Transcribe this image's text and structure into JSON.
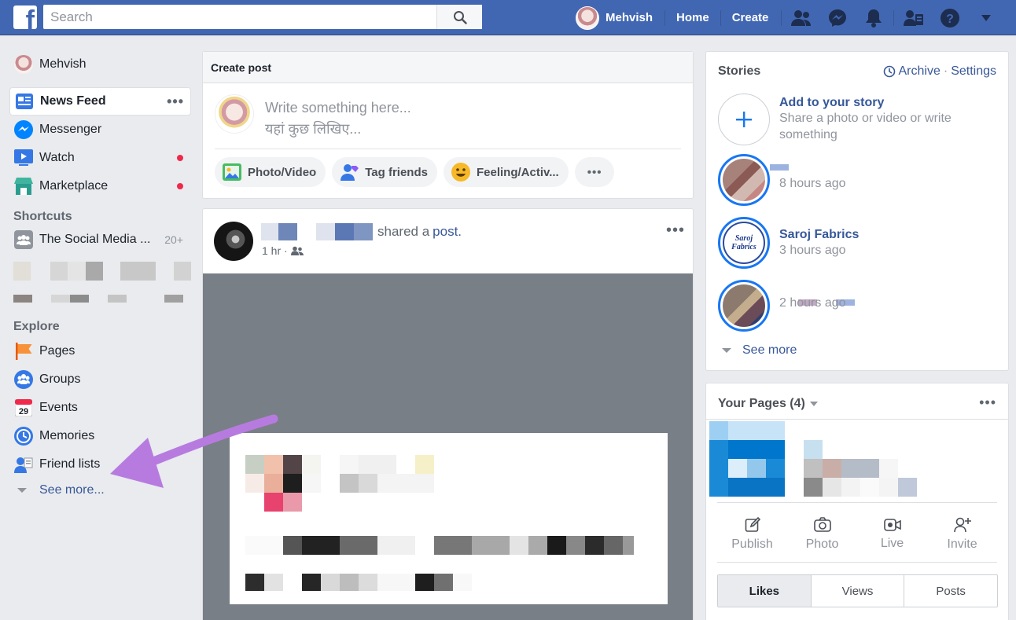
{
  "topbar": {
    "logo": "f",
    "search_placeholder": "Search",
    "user_name": "Mehvish",
    "links": [
      "Home",
      "Create"
    ],
    "icons": [
      "friend-requests-icon",
      "messenger-icon",
      "notifications-icon",
      "find-friends-icon",
      "help-icon",
      "chevron-down-icon"
    ]
  },
  "leftnav": {
    "profile": "Mehvish",
    "main": [
      {
        "label": "News Feed",
        "icon": "news-feed-icon",
        "active": true
      },
      {
        "label": "Messenger",
        "icon": "messenger-icon"
      },
      {
        "label": "Watch",
        "icon": "watch-icon",
        "dot": true
      },
      {
        "label": "Marketplace",
        "icon": "marketplace-icon",
        "dot": true
      }
    ],
    "shortcuts_heading": "Shortcuts",
    "shortcut": {
      "label": "The Social Media ...",
      "count": "20+"
    },
    "explore_heading": "Explore",
    "explore": [
      {
        "label": "Pages",
        "icon": "flag-icon"
      },
      {
        "label": "Groups",
        "icon": "groups-icon"
      },
      {
        "label": "Events",
        "icon": "calendar-icon",
        "day": "29"
      },
      {
        "label": "Memories",
        "icon": "memories-icon"
      },
      {
        "label": "Friend lists",
        "icon": "friend-lists-icon"
      }
    ],
    "see_more": "See more..."
  },
  "create_post": {
    "title": "Create post",
    "placeholder_en": "Write something here...",
    "placeholder_hi": "यहां कुछ लिखिए...",
    "actions": [
      "Photo/Video",
      "Tag friends",
      "Feeling/Activ..."
    ]
  },
  "feed_post": {
    "shared": "shared a",
    "post_link": "post.",
    "time": "1 hr ·"
  },
  "stories": {
    "title": "Stories",
    "archive": "Archive",
    "separator": "·",
    "settings": "Settings",
    "add_title": "Add to your story",
    "add_sub": "Share a photo or video or write something",
    "items": [
      {
        "name": "",
        "time": "8 hours ago"
      },
      {
        "name": "Saroj Fabrics",
        "time": "3 hours ago",
        "logo_text": "Saroj Fabrics"
      },
      {
        "name": "",
        "time": "2 hours ago"
      }
    ],
    "see_more": "See more"
  },
  "your_pages": {
    "title": "Your Pages (4)",
    "actions": [
      "Publish",
      "Photo",
      "Live",
      "Invite"
    ],
    "tabs": [
      "Likes",
      "Views",
      "Posts"
    ]
  },
  "colors": {
    "brand": "#4267b2",
    "link": "#385898",
    "arrow": "#b77be0",
    "badge_dot": "#f02849"
  }
}
